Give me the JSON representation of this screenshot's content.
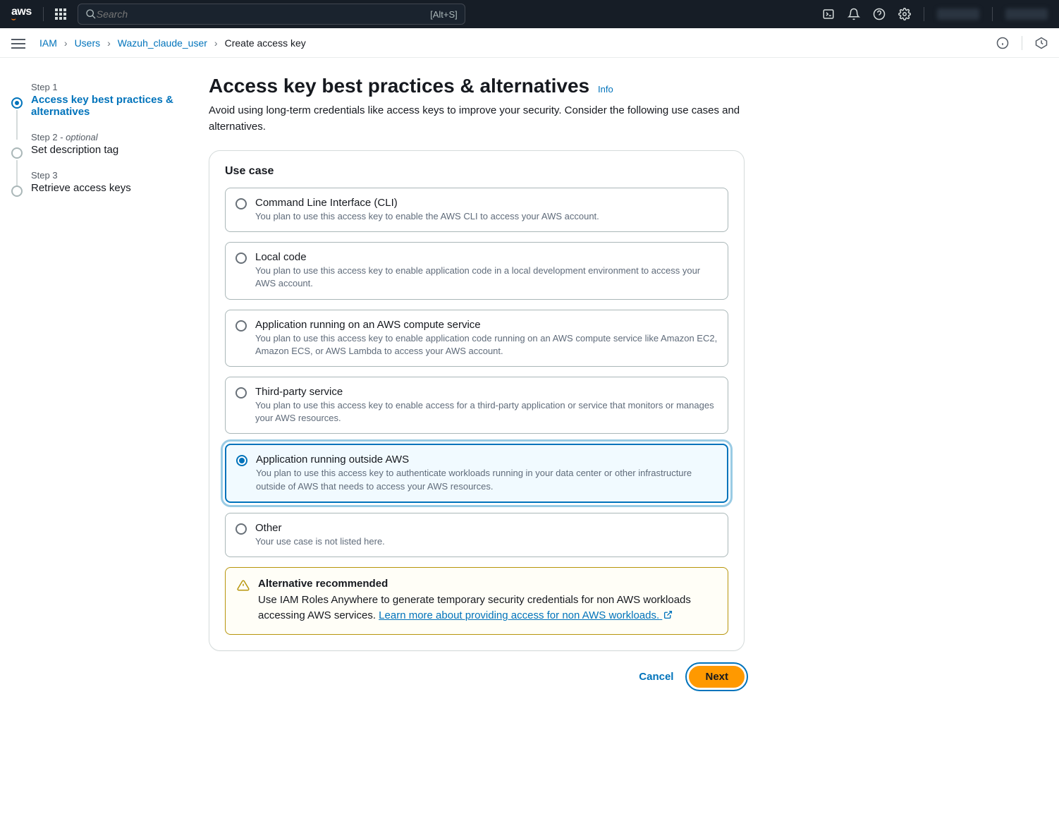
{
  "topnav": {
    "search_placeholder": "Search",
    "search_shortcut": "[Alt+S]"
  },
  "breadcrumbs": {
    "items": [
      "IAM",
      "Users",
      "Wazuh_claude_user",
      "Create access key"
    ]
  },
  "stepper": {
    "steps": [
      {
        "num": "Step 1",
        "title": "Access key best practices & alternatives"
      },
      {
        "num": "Step 2 - ",
        "opt": "optional",
        "title": "Set description tag"
      },
      {
        "num": "Step 3",
        "title": "Retrieve access keys"
      }
    ]
  },
  "page": {
    "title": "Access key best practices & alternatives",
    "info": "Info",
    "desc": "Avoid using long-term credentials like access keys to improve your security. Consider the following use cases and alternatives."
  },
  "panel": {
    "heading": "Use case",
    "options": [
      {
        "title": "Command Line Interface (CLI)",
        "desc": "You plan to use this access key to enable the AWS CLI to access your AWS account."
      },
      {
        "title": "Local code",
        "desc": "You plan to use this access key to enable application code in a local development environment to access your AWS account."
      },
      {
        "title": "Application running on an AWS compute service",
        "desc": "You plan to use this access key to enable application code running on an AWS compute service like Amazon EC2, Amazon ECS, or AWS Lambda to access your AWS account."
      },
      {
        "title": "Third-party service",
        "desc": "You plan to use this access key to enable access for a third-party application or service that monitors or manages your AWS resources."
      },
      {
        "title": "Application running outside AWS",
        "desc": "You plan to use this access key to authenticate workloads running in your data center or other infrastructure outside of AWS that needs to access your AWS resources."
      },
      {
        "title": "Other",
        "desc": "Your use case is not listed here."
      }
    ],
    "selected_index": 4,
    "alert": {
      "title": "Alternative recommended",
      "body_pre": "Use IAM Roles Anywhere to generate temporary security credentials for non AWS workloads accessing AWS services. ",
      "link": "Learn more about providing access for non AWS workloads."
    }
  },
  "actions": {
    "cancel": "Cancel",
    "next": "Next"
  }
}
